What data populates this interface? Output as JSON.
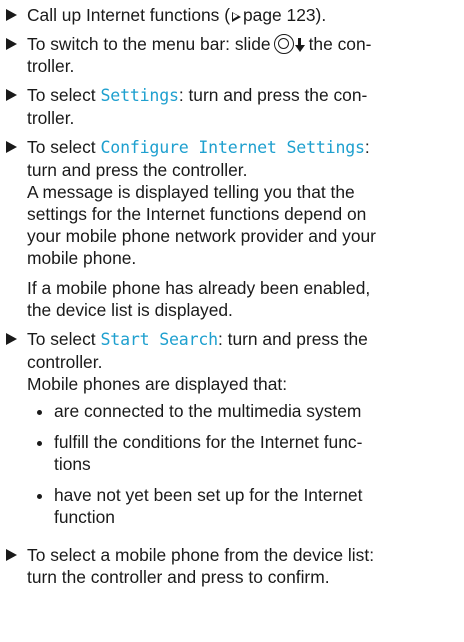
{
  "steps": [
    {
      "lines": [
        "Call up Internet functions (",
        "page 123)."
      ]
    },
    {
      "lines": [
        "To switch to the menu bar: slide",
        "the con-",
        "troller."
      ]
    },
    {
      "lines": [
        "To select",
        "Settings",
        ": turn and press the con-",
        "troller."
      ]
    },
    {
      "lines": [
        "To select",
        "Configure Internet Settings",
        ":",
        "turn and press the controller."
      ],
      "paragraphs": [
        [
          "A message is displayed telling you that the",
          "settings for the Internet functions depend on",
          "your mobile phone network provider and your",
          "mobile phone."
        ],
        [
          "If a mobile phone has already been enabled,",
          "the device list is displayed."
        ]
      ]
    },
    {
      "lines": [
        "To select",
        "Start Search",
        ": turn and press the",
        "controller."
      ],
      "paragraphs": [
        [
          "Mobile phones are displayed that:"
        ]
      ],
      "subitems": [
        [
          "are connected to the multimedia system"
        ],
        [
          "fulfill the conditions for the Internet func-",
          "tions"
        ],
        [
          "have not yet been set up for the Internet",
          "function"
        ]
      ]
    },
    {
      "lines": [
        "To select a mobile phone from the device list:",
        "turn the controller and press to confirm."
      ]
    }
  ],
  "icons": {
    "step_bullet": "triangle-bullet-icon",
    "page_ref": "page-reference-triangle-icon",
    "controller": "controller-knob-icon",
    "slide_down": "slide-down-arrow-icon",
    "list_dot": "bullet-dot-icon"
  },
  "colors": {
    "text": "#1a1a1a",
    "ui_text": "#1fa0cf"
  }
}
